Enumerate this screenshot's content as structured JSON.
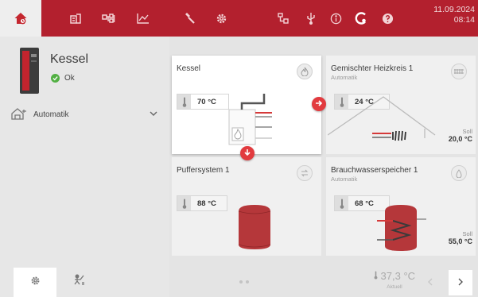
{
  "topbar": {
    "icons": [
      "home-icon",
      "building-icon",
      "network-icon",
      "chart-icon",
      "wrench-icon",
      "gear-icon",
      "plc-icon",
      "usb-icon",
      "info-icon",
      "connect-icon",
      "help-icon"
    ],
    "date": "11.09.2024",
    "time": "08:14"
  },
  "sidebar": {
    "title": "Kessel",
    "status": "Ok",
    "mode": "Automatik"
  },
  "cards": [
    {
      "title": "Kessel",
      "subtitle": "",
      "temp": "70 °C",
      "soll_label": "",
      "soll_value": ""
    },
    {
      "title": "Gemischter Heizkreis 1",
      "subtitle": "Automatik",
      "temp": "24 °C",
      "soll_label": "Soll",
      "soll_value": "20,0 °C"
    },
    {
      "title": "Puffersystem 1",
      "subtitle": "",
      "temp": "88 °C",
      "soll_label": "",
      "soll_value": ""
    },
    {
      "title": "Brauchwasserspeicher 1",
      "subtitle": "Automatik",
      "temp": "68 °C",
      "soll_label": "Soll",
      "soll_value": "55,0 °C"
    }
  ],
  "footer": {
    "outdoor_temp": "37,3 °C",
    "outdoor_label": "Aktuell"
  },
  "colors": {
    "brand": "#b3202e",
    "accent": "#e23b3f",
    "ok": "#52b043"
  }
}
